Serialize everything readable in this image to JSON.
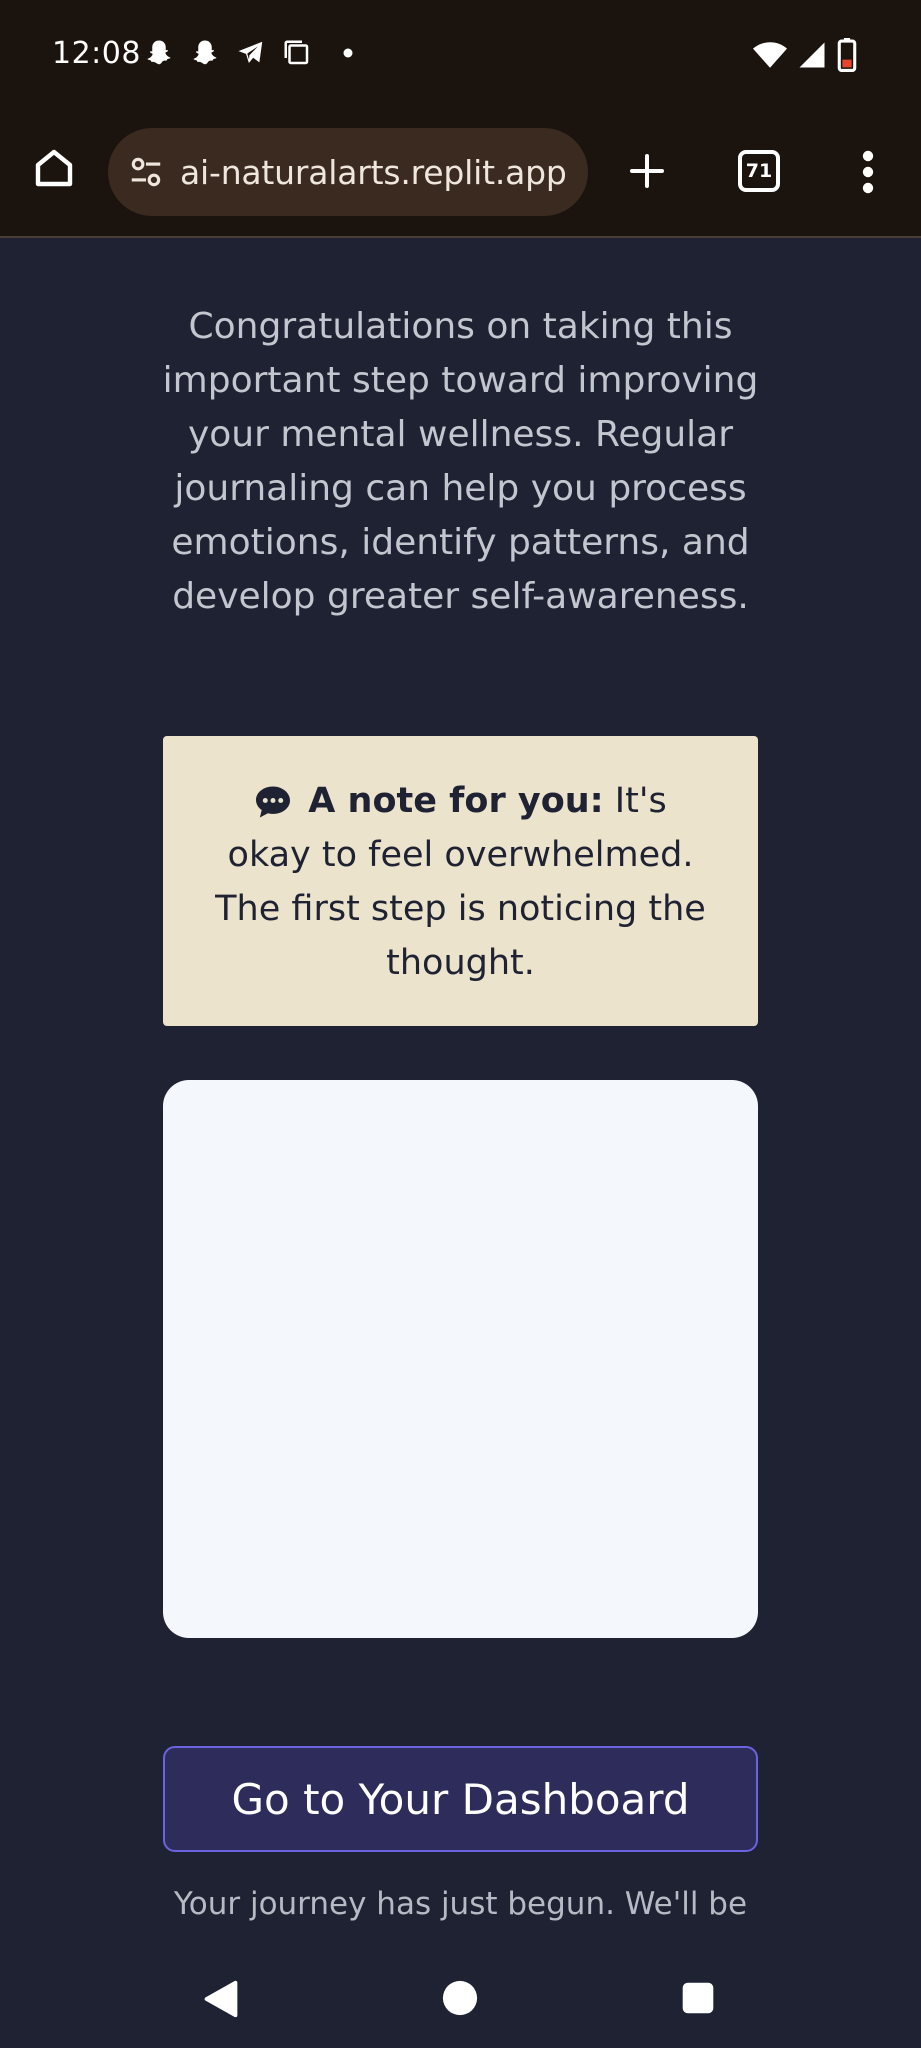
{
  "status_bar": {
    "time": "12:08",
    "left_icons": [
      "snapchat-icon",
      "snapchat-icon",
      "telegram-icon",
      "screenshot-icon",
      "dot-icon"
    ],
    "right_icons": [
      "wifi-icon",
      "cellular-signal-icon",
      "battery-low-icon"
    ],
    "battery_color": "#e5452e"
  },
  "browser": {
    "url": "ai-naturalarts.replit.app",
    "tab_count": "71",
    "toolbar_color": "#1b130d",
    "url_pill_color": "#3a2a1f"
  },
  "page": {
    "intro": "Congratulations on taking this important step toward improving your mental wellness. Regular journaling can help you process emotions, identify patterns, and develop greater self-awareness.",
    "note": {
      "label": "A note for you:",
      "text": " It's okay to feel overwhelmed. The first step is noticing the thought.",
      "icon": "speech-bubble-icon"
    },
    "dashboard_button": "Go to Your Dashboard",
    "footer": "Your journey has just begun. We'll be",
    "colors": {
      "background": "#1e2232",
      "note_background": "#ebe3cc",
      "card_background": "#f4f8fc",
      "button_background": "#2e2c5a",
      "button_border": "#6b63e0"
    }
  },
  "nav_bar": {
    "buttons": [
      "back-icon",
      "home-icon",
      "recents-icon"
    ]
  }
}
